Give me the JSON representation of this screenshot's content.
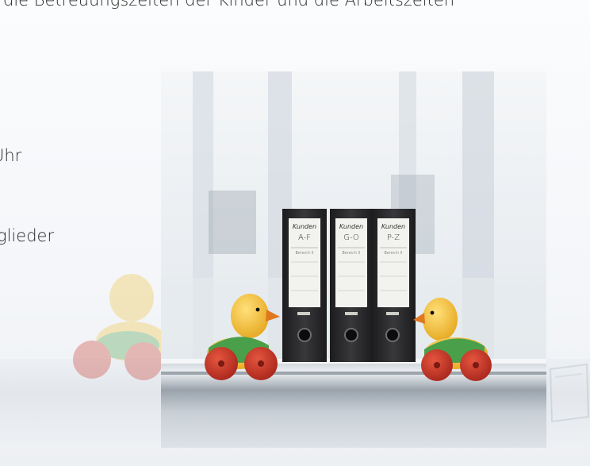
{
  "intro_text": "d die Betreuungszeiten der Kinder und die Arbeitszeiten",
  "lines": {
    "uhr": "Uhr",
    "glieder": "glieder"
  },
  "binders": [
    {
      "title": "Kunden",
      "range": "A-F",
      "sub": "Bereich II"
    },
    {
      "title": "Kunden",
      "range": "G-O",
      "sub": "Bereich II"
    },
    {
      "title": "Kunden",
      "range": "P-Z",
      "sub": "Bereich II"
    }
  ],
  "colors": {
    "binder": "#2b2b2d",
    "duck_yellow": "#f2c23a",
    "duck_green": "#4aa04a",
    "wheel_red": "#c83a2c",
    "beak_orange": "#e0781e"
  }
}
